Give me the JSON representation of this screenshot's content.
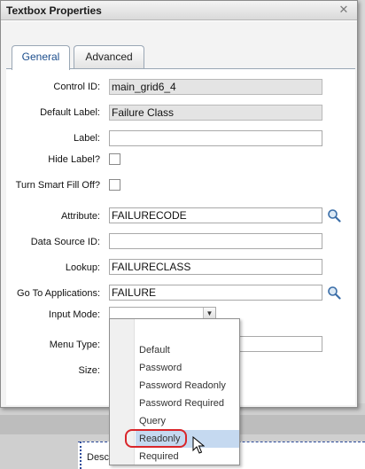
{
  "dialog": {
    "title": "Textbox Properties",
    "close_glyph": "✕"
  },
  "tabs": [
    {
      "label": "General",
      "active": true
    },
    {
      "label": "Advanced",
      "active": false
    }
  ],
  "form": {
    "control_id": {
      "label": "Control ID:",
      "value": "main_grid6_4"
    },
    "default_label": {
      "label": "Default Label:",
      "value": "Failure Class"
    },
    "label": {
      "label": "Label:",
      "value": ""
    },
    "hide_label": {
      "label": "Hide Label?",
      "checked": false
    },
    "smart_fill_off": {
      "label": "Turn Smart Fill Off?",
      "checked": false
    },
    "attribute": {
      "label": "Attribute:",
      "value": "FAILURECODE"
    },
    "data_source_id": {
      "label": "Data Source ID:",
      "value": ""
    },
    "lookup": {
      "label": "Lookup:",
      "value": "FAILURECLASS"
    },
    "go_to_apps": {
      "label": "Go To Applications:",
      "value": "FAILURE"
    },
    "input_mode": {
      "label": "Input Mode:",
      "value": ""
    },
    "menu_type": {
      "label": "Menu Type:",
      "value": ""
    },
    "size": {
      "label": "Size:",
      "value": ""
    }
  },
  "input_mode_options": [
    "Default",
    "Password",
    "Password Readonly",
    "Password Required",
    "Query",
    "Readonly",
    "Required"
  ],
  "input_mode_highlighted": "Readonly",
  "background": {
    "partial_text": "Desc"
  },
  "colors": {
    "accent": "#1b4d8c",
    "highlight_ring": "#d9262b",
    "selection": "#c5d9f0"
  }
}
